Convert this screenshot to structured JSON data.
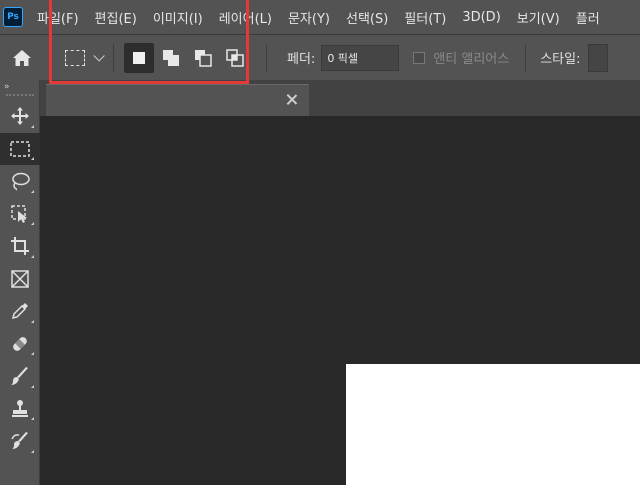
{
  "app": {
    "logo_text": "Ps"
  },
  "menu": {
    "items": [
      {
        "label": "파일(F)"
      },
      {
        "label": "편집(E)"
      },
      {
        "label": "이미지(I)"
      },
      {
        "label": "레이어(L)"
      },
      {
        "label": "문자(Y)"
      },
      {
        "label": "선택(S)"
      },
      {
        "label": "필터(T)"
      },
      {
        "label": "3D(D)"
      },
      {
        "label": "보기(V)"
      },
      {
        "label": "플러"
      }
    ]
  },
  "options": {
    "feather_label": "페더:",
    "feather_value": "0 픽셀",
    "antialias_label": "앤티 앨리어스",
    "antialias_checked": false,
    "style_label": "스타일:"
  },
  "toolbar": {
    "grip": "»",
    "tools": [
      {
        "icon": "move-icon"
      },
      {
        "icon": "rectangular-marquee-icon",
        "active": true
      },
      {
        "icon": "lasso-icon"
      },
      {
        "icon": "object-selection-icon"
      },
      {
        "icon": "crop-icon"
      },
      {
        "icon": "frame-icon"
      },
      {
        "icon": "eyedropper-icon"
      },
      {
        "icon": "healing-brush-icon"
      },
      {
        "icon": "brush-icon"
      },
      {
        "icon": "clone-stamp-icon"
      },
      {
        "icon": "history-brush-icon"
      }
    ]
  },
  "colors": {
    "panel": "#535353",
    "canvas_bg": "#282828",
    "highlight": "#e53935",
    "document": "#ffffff",
    "accent": "#31a8ff"
  }
}
